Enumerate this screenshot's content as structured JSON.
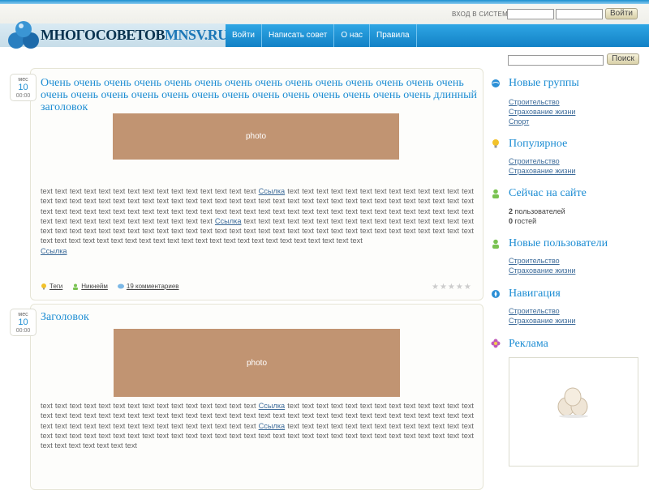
{
  "header": {
    "logo_main": "МНОГОСОВЕТОВ",
    "logo_accent": "MNSV.RU",
    "login_label": "ВХОД В СИСТЕМУ",
    "login_button": "Войти",
    "nav": [
      "Войти",
      "Написать совет",
      "О нас",
      "Правила"
    ]
  },
  "search": {
    "button": "Поиск"
  },
  "posts": [
    {
      "date": {
        "month": "мес",
        "day": "10",
        "time": "00:00"
      },
      "title": "Очень очень очень очень очень очень очень очень очень очень очень очень очень очень очень очень очень очень очень очень очень очень очень очень очень очень очень длинный заголовок",
      "photo": "photo",
      "text_a": "text text text text text text text text text text text text text text text",
      "link_a": "Ссылка",
      "text_b": "text text text text text text text text text text text text text text text text text text text text text text text text text text text text text text text text text text text text text text text text text text text text text text text text text text text text text text text text text text text text text text text text text text text text text text text text text text text text text text text text text text text text text",
      "link_b": "Ссылка",
      "text_c": "text text text text text text text text text text text text text text text text text text text text text text text text text text text text text text text text text text text text text text text text text text text text text text text text text text text text text text text text text text text text text text text text text text text text text",
      "link_c": "Ссылка",
      "tags": "Теги",
      "author": "Никнейм",
      "comments": "19 комментариев",
      "stars": "★★★★★"
    },
    {
      "date": {
        "month": "мес",
        "day": "10",
        "time": "00:00"
      },
      "title": "Заголовок",
      "photo": "photo",
      "text_a": "text text text text text text text text text text text text text text text",
      "link_a": "Ссылка",
      "text_b": "text text text text text text text text text text text text text text text text text text text text text text text text text text text text text text text text text text text text text text text text text text text text text text text text text text text text text text text text text text",
      "link_b": "Ссылка",
      "text_c": "text text text text text text text text text text text text text text text text text text text text text text text text text text text text text text text text text text text text text text text text text text text text text text text text text text"
    }
  ],
  "sidebar": {
    "new_groups": {
      "title": "Новые группы",
      "links": [
        "Строительство",
        "Страхование жизни",
        "Спорт"
      ]
    },
    "popular": {
      "title": "Популярное",
      "links": [
        "Строительство",
        "Страхование жизни"
      ]
    },
    "online": {
      "title": "Сейчас на сайте",
      "users_count": "2",
      "users_label": "пользователей",
      "guests_count": "0",
      "guests_label": "гостей"
    },
    "new_users": {
      "title": "Новые пользователи",
      "links": [
        "Строительство",
        "Страхование жизни"
      ]
    },
    "navigation": {
      "title": "Навигация",
      "links": [
        "Строительство",
        "Страхование жизни"
      ]
    },
    "ads": {
      "title": "Реклама"
    }
  },
  "colors": {
    "accent": "#1d8dd3",
    "nav": "#1b8fd0",
    "photo": "#c19472"
  }
}
